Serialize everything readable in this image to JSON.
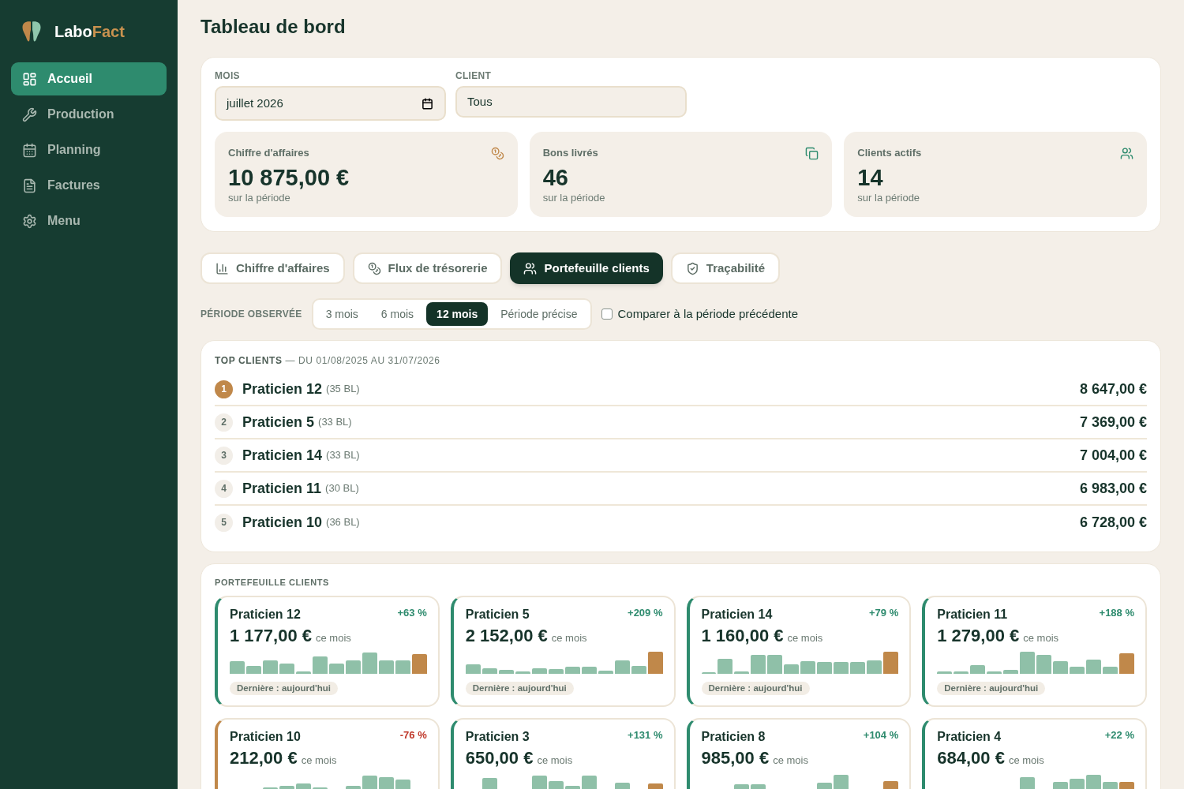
{
  "sidebar": {
    "logo": {
      "text_start": "Labo",
      "text_end": "Fact"
    },
    "items": [
      {
        "label": "Accueil",
        "selected": true
      },
      {
        "label": "Production",
        "selected": false
      },
      {
        "label": "Planning",
        "selected": false
      },
      {
        "label": "Factures",
        "selected": false
      },
      {
        "label": "Menu",
        "selected": false
      }
    ]
  },
  "page": {
    "title": "Tableau de bord"
  },
  "filters": {
    "month": {
      "label": "MOIS",
      "value": "juillet 2026"
    },
    "client": {
      "label": "CLIENT",
      "value": "Tous"
    }
  },
  "stats": [
    {
      "label": "Chiffre d'affaires",
      "value": "10 875,00 €",
      "caption": "sur la période"
    },
    {
      "label": "Bons livrés",
      "value": "46",
      "caption": "sur la période"
    },
    {
      "label": "Clients actifs",
      "value": "14",
      "caption": "sur la période"
    }
  ],
  "tabs": [
    {
      "label": "Chiffre d'affaires",
      "selected": false
    },
    {
      "label": "Flux de trésorerie",
      "selected": false
    },
    {
      "label": "Portefeuille clients",
      "selected": true
    },
    {
      "label": "Traçabilité",
      "selected": false
    }
  ],
  "period": {
    "label": "PÉRIODE OBSERVÉE",
    "options": [
      {
        "label": "3 mois",
        "selected": false
      },
      {
        "label": "6 mois",
        "selected": false
      },
      {
        "label": "12 mois",
        "selected": true
      },
      {
        "label": "Période précise",
        "selected": false
      }
    ],
    "compare": {
      "label": "Comparer à la période précédente",
      "checked": false
    }
  },
  "top_clients": {
    "title": "**TOP CLIENTS** — DU 01/08/2025 AU 31/07/2026",
    "rows": [
      {
        "rank": "1",
        "name": "Praticien 12",
        "count": "(35 BL)",
        "amount": "8 647,00 €",
        "highlighted": true
      },
      {
        "rank": "2",
        "name": "Praticien 5",
        "count": "(33 BL)",
        "amount": "7 369,00 €",
        "highlighted": false
      },
      {
        "rank": "3",
        "name": "Praticien 14",
        "count": "(33 BL)",
        "amount": "7 004,00 €",
        "highlighted": false
      },
      {
        "rank": "4",
        "name": "Praticien 11",
        "count": "(30 BL)",
        "amount": "6 983,00 €",
        "highlighted": false
      },
      {
        "rank": "5",
        "name": "Praticien 10",
        "count": "(36 BL)",
        "amount": "6 728,00 €",
        "highlighted": false
      }
    ]
  },
  "portfolio": {
    "title": "PORTEFEUILLE CLIENTS",
    "cards": [
      {
        "name": "Praticien 12",
        "delta": "+63 %",
        "declining": false,
        "amount": "1 177,00 €",
        "unit": "ce mois",
        "last": "Dernière : aujourd'hui"
      },
      {
        "name": "Praticien 5",
        "delta": "+209 %",
        "declining": false,
        "amount": "2 152,00 €",
        "unit": "ce mois",
        "last": "Dernière : aujourd'hui"
      },
      {
        "name": "Praticien 14",
        "delta": "+79 %",
        "declining": false,
        "amount": "1 160,00 €",
        "unit": "ce mois",
        "last": "Dernière : aujourd'hui"
      },
      {
        "name": "Praticien 11",
        "delta": "+188 %",
        "declining": false,
        "amount": "1 279,00 €",
        "unit": "ce mois",
        "last": "Dernière : aujourd'hui"
      },
      {
        "name": "Praticien 10",
        "delta": "-76 %",
        "declining": true,
        "amount": "212,00 €",
        "unit": "ce mois"
      },
      {
        "name": "Praticien 3",
        "delta": "+131 %",
        "declining": false,
        "amount": "650,00 €",
        "unit": "ce mois"
      },
      {
        "name": "Praticien 8",
        "delta": "+104 %",
        "declining": false,
        "amount": "985,00 €",
        "unit": "ce mois"
      },
      {
        "name": "Praticien 4",
        "delta": "+22 %",
        "declining": false,
        "amount": "684,00 €",
        "unit": "ce mois"
      }
    ]
  }
}
